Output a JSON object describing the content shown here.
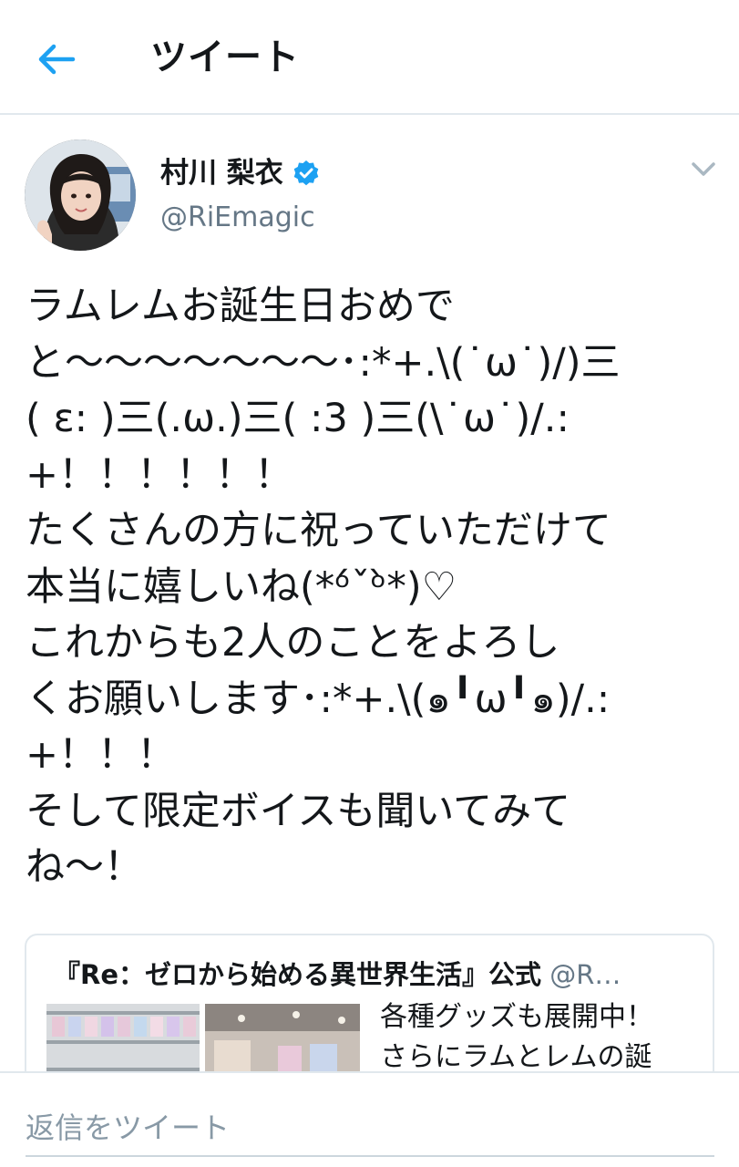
{
  "header": {
    "back_icon": "arrow-left-icon",
    "title": "ツイート",
    "accent_color": "#1da1f2"
  },
  "author": {
    "name": "村川 梨衣",
    "handle": "@RiEmagic",
    "verified": true,
    "verified_icon": "verified-badge-icon",
    "menu_icon": "chevron-down-icon"
  },
  "tweet": {
    "lines": [
      "ラムレムお誕生日おめで",
      "と〜〜〜〜〜〜〜･:*+.\\(˙ω˙)/)三",
      "( ε: )三(.ω.)三( :3 )三(\\˙ω˙)/.:",
      "+！！！！！！",
      "たくさんの方に祝っていただけて",
      "本当に嬉しいね(*ᵒ́ˇᵒ̀*)♡",
      "これからも2人のことをよろし",
      "くお願いします･:*+.\\(๑╹ω╹๑)/.:",
      "+！！！",
      "そして限定ボイスも聞いてみて",
      "ね〜！"
    ]
  },
  "card": {
    "title": "『Re：ゼロから始める異世界生活』公式",
    "handle": "@R…",
    "desc_lines": [
      "各種グッズも展開中！",
      "さらにラムとレムの誕"
    ]
  },
  "reply": {
    "placeholder": "返信をツイート"
  }
}
